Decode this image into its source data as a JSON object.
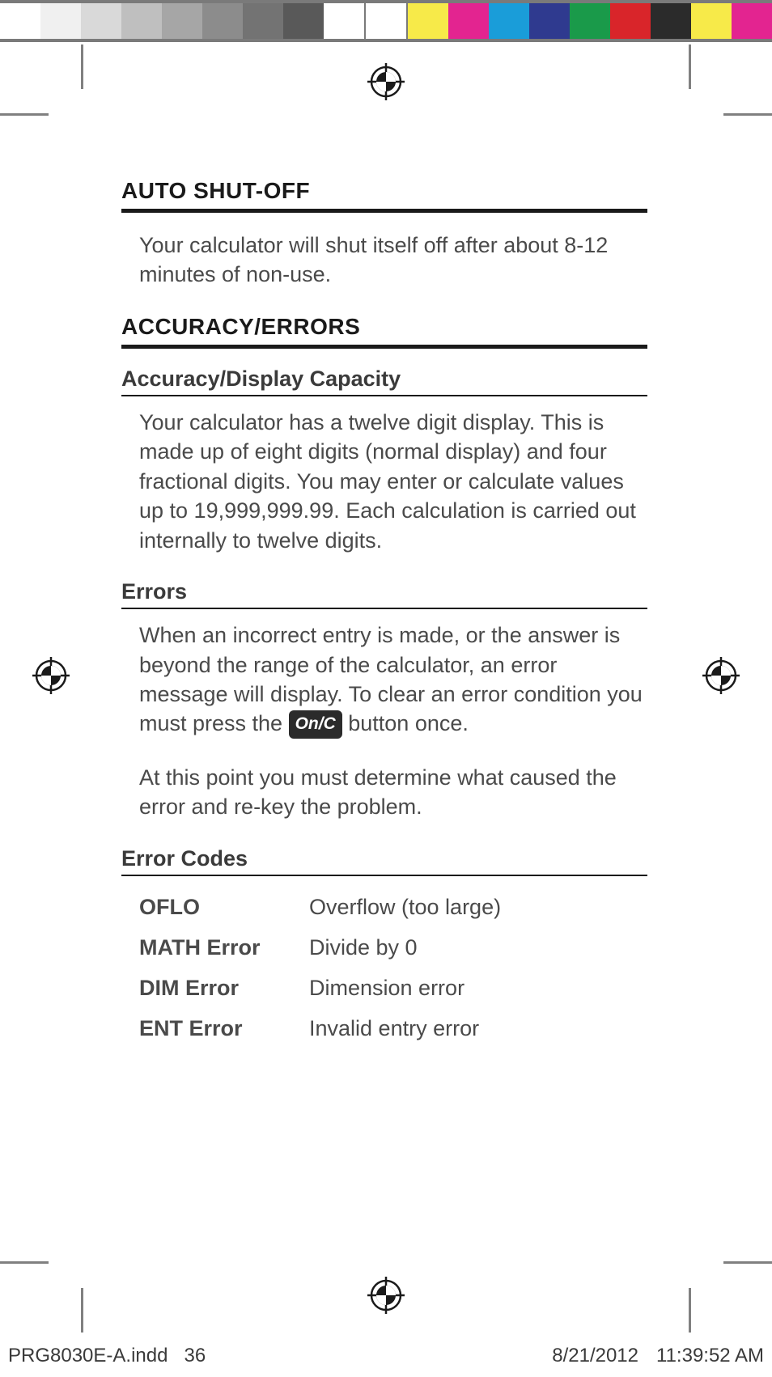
{
  "colorbar": [
    "#ffffff",
    "#f0f0f0",
    "#d9d9d9",
    "#bfbfbf",
    "#a6a6a6",
    "#8c8c8c",
    "#737373",
    "#595959",
    "#ffffff",
    "#ffffff",
    "#f7ea49",
    "#e32490",
    "#1a9dd9",
    "#2f3a8f",
    "#1a9a4a",
    "#d9252a",
    "#2b2b2b",
    "#f7ea49",
    "#e32490"
  ],
  "sections": {
    "auto_shutoff": {
      "title": "AUTO SHUT-OFF",
      "body": "Your calculator will shut itself off after about 8-12 minutes of non-use."
    },
    "accuracy_errors": {
      "title": "ACCURACY/ERRORS",
      "display_capacity": {
        "title": "Accuracy/Display Capacity",
        "body": "Your calculator has a twelve digit display. This is made up of eight digits (normal display) and four fractional digits. You may enter or calculate values up to 19,999,999.99. Each calculation is carried out internally to twelve digits."
      },
      "errors": {
        "title": "Errors",
        "body_pre": "When an incorrect entry is made, or the answer is beyond the range of the calculator, an error message will display. To clear an error condition you must press the ",
        "key_label": "On/C",
        "body_post": " button once.",
        "body2": "At this point you must determine what caused the error and re-key the problem."
      },
      "error_codes": {
        "title": "Error Codes",
        "rows": [
          {
            "code": "OFLO",
            "desc": "Overflow (too large)"
          },
          {
            "code": "MATH Error",
            "desc": "Divide by 0"
          },
          {
            "code": "DIM Error",
            "desc": "Dimension error"
          },
          {
            "code": "ENT Error",
            "desc": "Invalid entry error"
          }
        ]
      }
    }
  },
  "footer": {
    "file": "PRG8030E-A.indd",
    "page": "36",
    "date": "8/21/2012",
    "time": "11:39:52 AM"
  }
}
